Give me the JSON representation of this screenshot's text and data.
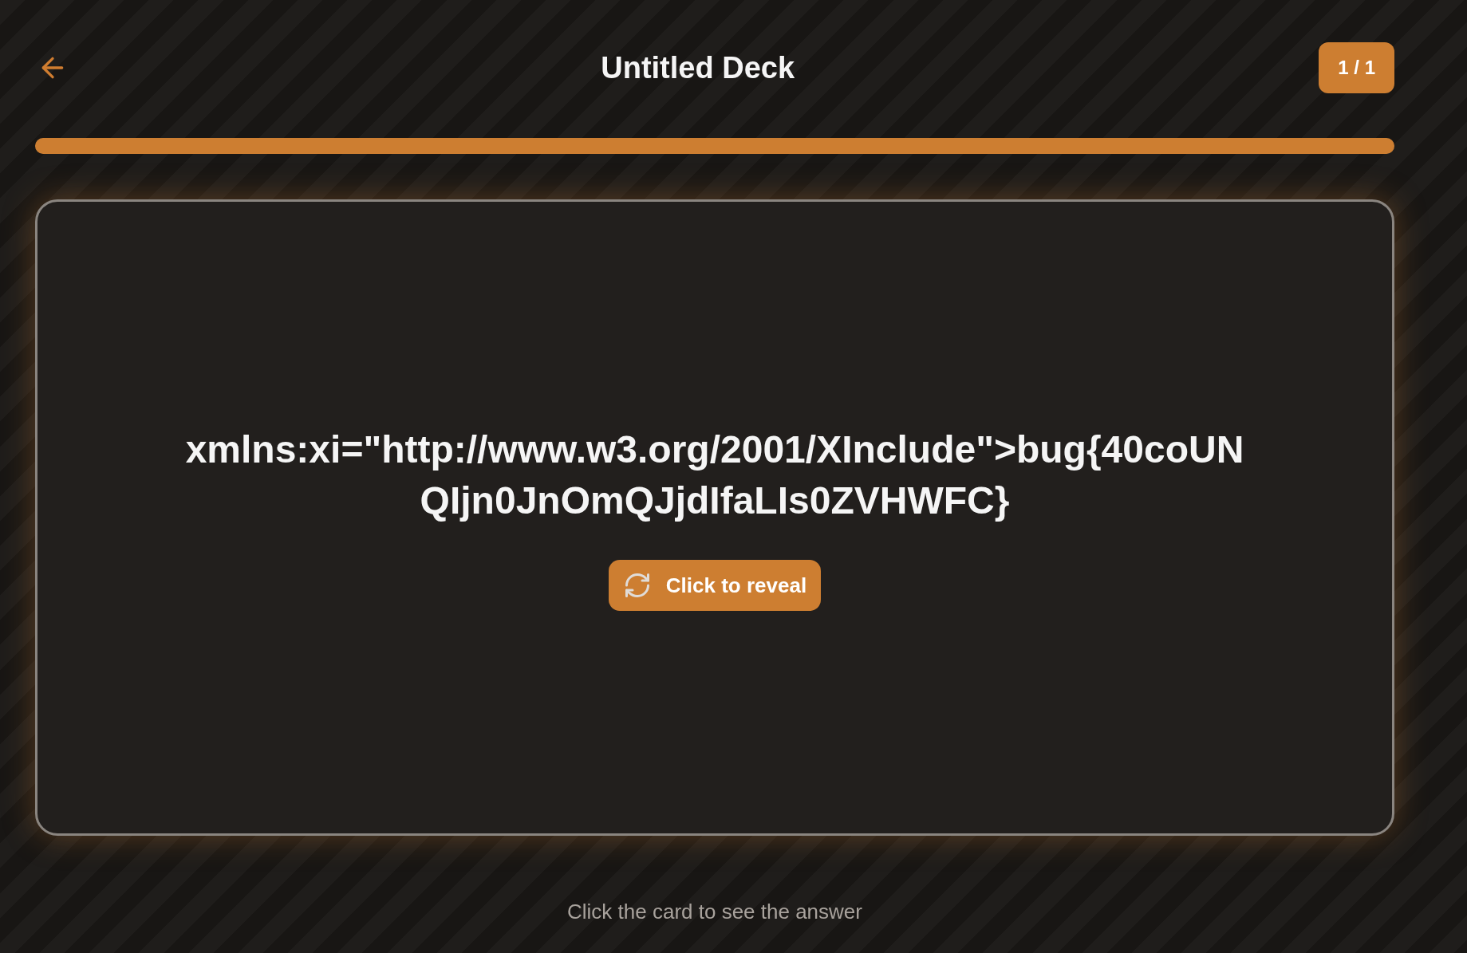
{
  "header": {
    "title": "Untitled Deck",
    "counter": "1 / 1"
  },
  "progress": {
    "level": 1
  },
  "card": {
    "question": "xmlns:xi=\"http://www.w3.org/2001/XInclude\">bug{40coUNQIjn0JnOmQJjdIfaLIs0ZVHWFC}",
    "reveal_button": "Click to reveal"
  },
  "hint": "Click the card to see the answer"
}
